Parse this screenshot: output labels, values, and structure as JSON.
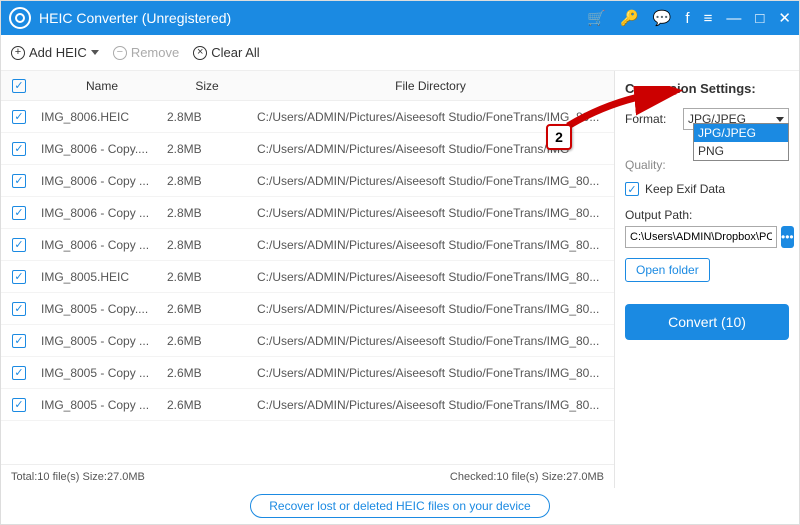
{
  "titlebar": {
    "title": "HEIC Converter (Unregistered)"
  },
  "toolbar": {
    "add_label": "Add HEIC",
    "remove_label": "Remove",
    "clear_label": "Clear All"
  },
  "table": {
    "headers": {
      "name": "Name",
      "size": "Size",
      "path": "File Directory"
    },
    "rows": [
      {
        "name": "IMG_8006.HEIC",
        "size": "2.8MB",
        "path": "C:/Users/ADMIN/Pictures/Aiseesoft Studio/FoneTrans/IMG_80..."
      },
      {
        "name": "IMG_8006 - Copy....",
        "size": "2.8MB",
        "path": "C:/Users/ADMIN/Pictures/Aiseesoft Studio/FoneTrans/IMG"
      },
      {
        "name": "IMG_8006 - Copy ...",
        "size": "2.8MB",
        "path": "C:/Users/ADMIN/Pictures/Aiseesoft Studio/FoneTrans/IMG_80..."
      },
      {
        "name": "IMG_8006 - Copy ...",
        "size": "2.8MB",
        "path": "C:/Users/ADMIN/Pictures/Aiseesoft Studio/FoneTrans/IMG_80..."
      },
      {
        "name": "IMG_8006 - Copy ...",
        "size": "2.8MB",
        "path": "C:/Users/ADMIN/Pictures/Aiseesoft Studio/FoneTrans/IMG_80..."
      },
      {
        "name": "IMG_8005.HEIC",
        "size": "2.6MB",
        "path": "C:/Users/ADMIN/Pictures/Aiseesoft Studio/FoneTrans/IMG_80..."
      },
      {
        "name": "IMG_8005 - Copy....",
        "size": "2.6MB",
        "path": "C:/Users/ADMIN/Pictures/Aiseesoft Studio/FoneTrans/IMG_80..."
      },
      {
        "name": "IMG_8005 - Copy ...",
        "size": "2.6MB",
        "path": "C:/Users/ADMIN/Pictures/Aiseesoft Studio/FoneTrans/IMG_80..."
      },
      {
        "name": "IMG_8005 - Copy ...",
        "size": "2.6MB",
        "path": "C:/Users/ADMIN/Pictures/Aiseesoft Studio/FoneTrans/IMG_80..."
      },
      {
        "name": "IMG_8005 - Copy ...",
        "size": "2.6MB",
        "path": "C:/Users/ADMIN/Pictures/Aiseesoft Studio/FoneTrans/IMG_80..."
      }
    ]
  },
  "settings": {
    "heading": "Conversion Settings:",
    "format_label": "Format:",
    "format_value": "JPG/JPEG",
    "format_options": [
      "JPG/JPEG",
      "PNG"
    ],
    "quality_label": "Quality:",
    "keep_exif_label": "Keep Exif Data",
    "output_label": "Output Path:",
    "output_path": "C:\\Users\\ADMIN\\Dropbox\\PC\\",
    "open_folder_label": "Open folder",
    "convert_label": "Convert (10)"
  },
  "status": {
    "left": "Total:10 file(s) Size:27.0MB",
    "right": "Checked:10 file(s) Size:27.0MB"
  },
  "footer": {
    "recover_label": "Recover lost or deleted HEIC files on your device"
  },
  "callout": {
    "step": "2"
  }
}
